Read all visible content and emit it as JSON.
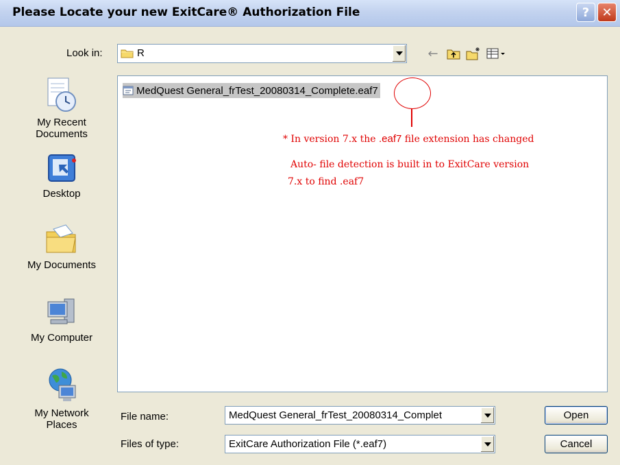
{
  "window": {
    "title": "Please Locate your new ExitCare® Authorization File"
  },
  "title_buttons": {
    "help": "?",
    "close": "✕"
  },
  "look_in": {
    "label": "Look in:",
    "value": "R"
  },
  "toolbar": {
    "back_glyph": "←"
  },
  "places": [
    {
      "label": "My Recent\nDocuments",
      "icon": "recent-documents-icon"
    },
    {
      "label": "Desktop",
      "icon": "desktop-icon"
    },
    {
      "label": "My Documents",
      "icon": "my-documents-icon"
    },
    {
      "label": "My Computer",
      "icon": "my-computer-icon"
    },
    {
      "label": "My Network\nPlaces",
      "icon": "network-places-icon"
    }
  ],
  "files": [
    {
      "name": "MedQuest General_frTest_20080314_Complete.eaf7",
      "selected": true
    }
  ],
  "annotations": {
    "line1_prefix": "* In version 7.x the ",
    "line1_ext": ".eaf7",
    "line1_suffix": " file extension has changed",
    "line2": "Auto- file detection  is built in to ExitCare version",
    "line3": "7.x  to find .eaf7",
    "color": "#e00000"
  },
  "file_name": {
    "label": "File name:",
    "value": "MedQuest General_frTest_20080314_Complet"
  },
  "files_of_type": {
    "label": "Files of type:",
    "value": "ExitCare Authorization File (*.eaf7)"
  },
  "buttons": {
    "open": "Open",
    "cancel": "Cancel"
  }
}
